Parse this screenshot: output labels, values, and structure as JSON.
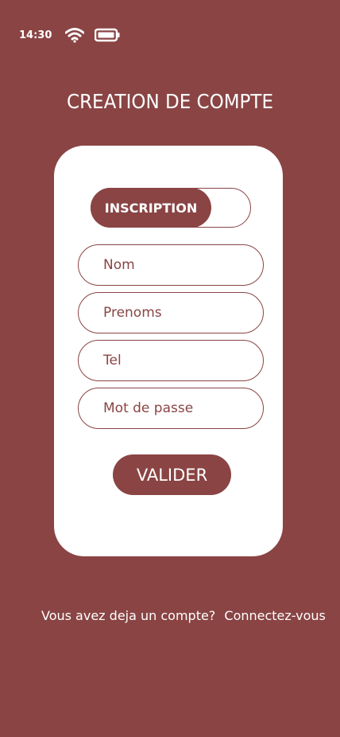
{
  "status_bar": {
    "time": "14:30",
    "icons": [
      "wifi-icon",
      "battery-icon"
    ]
  },
  "header": {
    "title": "CREATION DE COMPTE"
  },
  "card": {
    "toggle": {
      "active_label": "INSCRIPTION"
    },
    "fields": [
      {
        "placeholder": "Nom",
        "value": ""
      },
      {
        "placeholder": "Prenoms",
        "value": ""
      },
      {
        "placeholder": "Tel",
        "value": ""
      },
      {
        "placeholder": "Mot de passe",
        "value": ""
      }
    ],
    "submit_label": "VALIDER"
  },
  "footer": {
    "prompt": "Vous avez deja un compte?",
    "link": "Connectez-vous"
  },
  "colors": {
    "background": "#8a4444",
    "card": "#ffffff",
    "accent": "#8a4444"
  }
}
